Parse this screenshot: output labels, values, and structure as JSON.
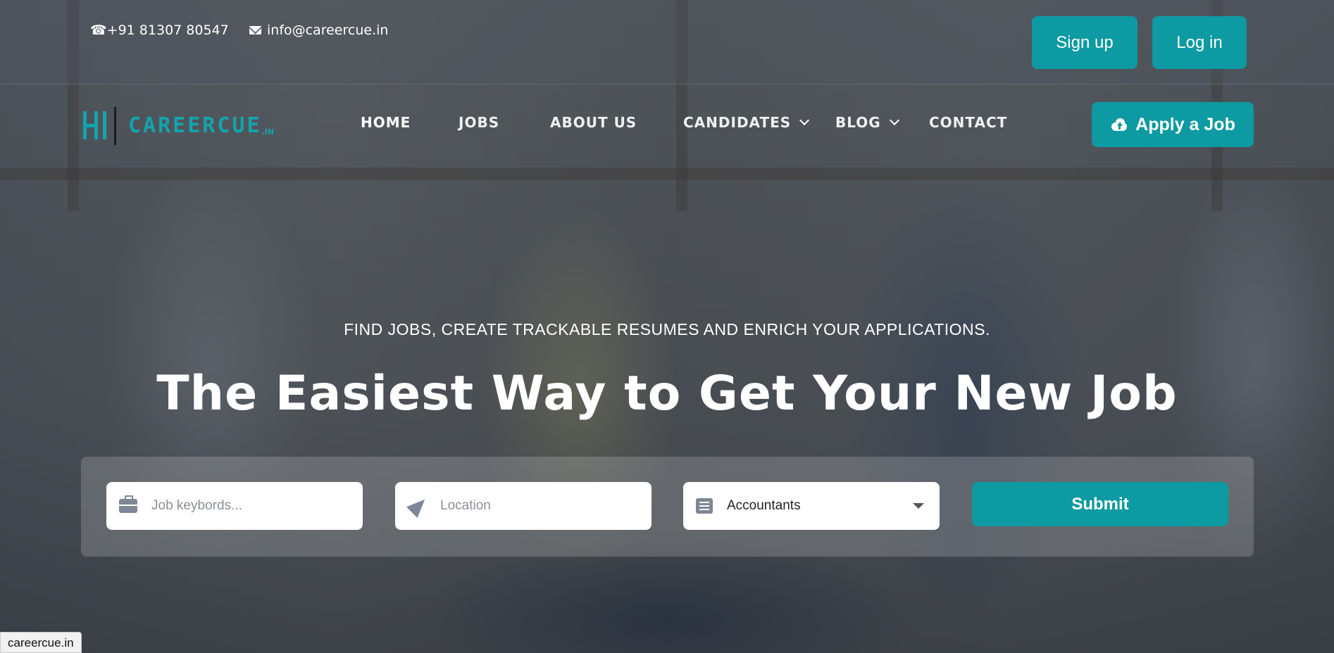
{
  "topbar": {
    "phone": "☎+91 81307 80547",
    "email": "info@careercue.in",
    "signup_label": "Sign up",
    "login_label": "Log in"
  },
  "brand": {
    "name": "CAREERCUE",
    "suffix": ".IN",
    "accent": "#0d9aa2"
  },
  "nav": {
    "items": [
      {
        "label": "HOME",
        "active": true
      },
      {
        "label": "JOBS"
      },
      {
        "label": "ABOUT US"
      },
      {
        "label": "CANDIDATES",
        "dropdown": true
      },
      {
        "label": "BLOG",
        "dropdown": true
      },
      {
        "label": "CONTACT"
      }
    ],
    "apply_label": "Apply a Job"
  },
  "hero": {
    "tagline": "FIND JOBS, CREATE TRACKABLE RESUMES AND ENRICH YOUR APPLICATIONS.",
    "headline": "The Easiest Way to Get Your New Job"
  },
  "search": {
    "keywords_placeholder": "Job keybords...",
    "location_placeholder": "Location",
    "category_selected": "Accountants",
    "submit_label": "Submit"
  },
  "status_bar": {
    "url": "careercue.in"
  }
}
